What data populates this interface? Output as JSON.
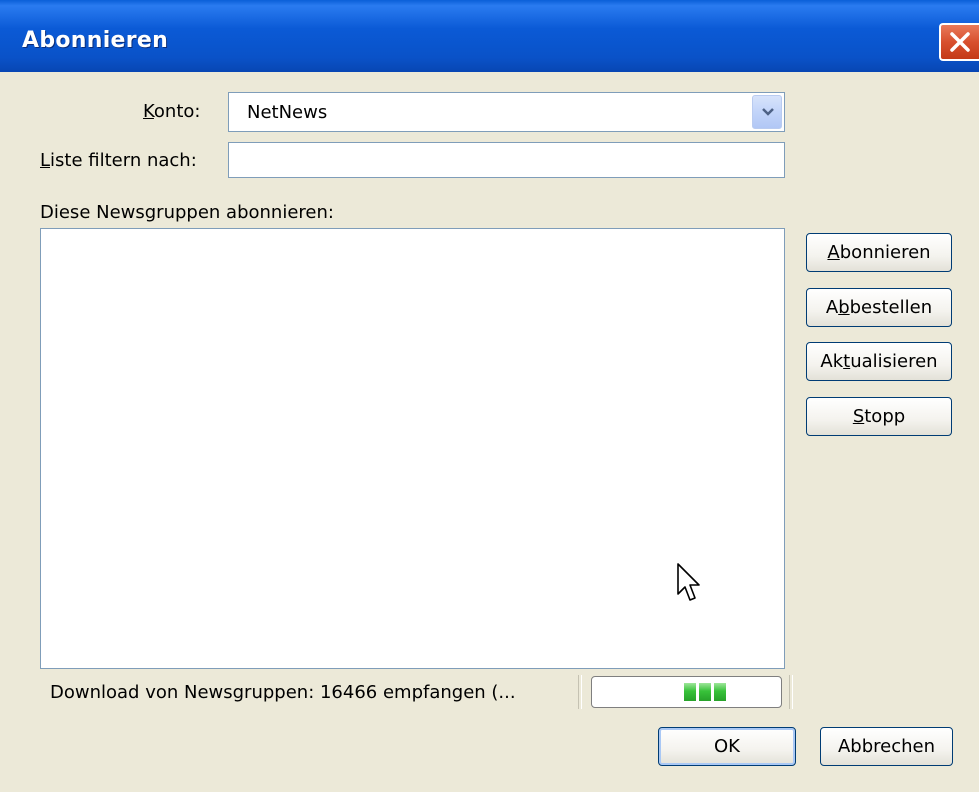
{
  "window": {
    "title": "Abonnieren",
    "colors": {
      "titlebar": "#0a52c8",
      "close": "#d8502e",
      "face": "#ece9d8"
    }
  },
  "icons": {
    "close": "close-icon",
    "dropdown": "chevron-down-icon",
    "cursor": "mouse-pointer-icon"
  },
  "konto": {
    "label_u": "K",
    "label_rest": "onto:",
    "value": "NetNews"
  },
  "filter": {
    "label_u": "L",
    "label_rest": "iste filtern nach:",
    "value": ""
  },
  "list": {
    "label": "Diese Newsgruppen abonnieren:"
  },
  "buttons": {
    "subscribe": {
      "pre": "",
      "u": "A",
      "post": "bonnieren"
    },
    "unsubscribe": {
      "pre": "A",
      "u": "b",
      "post": "bestellen"
    },
    "refresh": {
      "pre": "Ak",
      "u": "t",
      "post": "ualisieren"
    },
    "stop": {
      "pre": "",
      "u": "S",
      "post": "topp"
    },
    "ok": "OK",
    "cancel": "Abbrechen"
  },
  "status": {
    "text": "Download von Newsgruppen: 16466 empfangen (...",
    "progress_blocks": 3
  }
}
